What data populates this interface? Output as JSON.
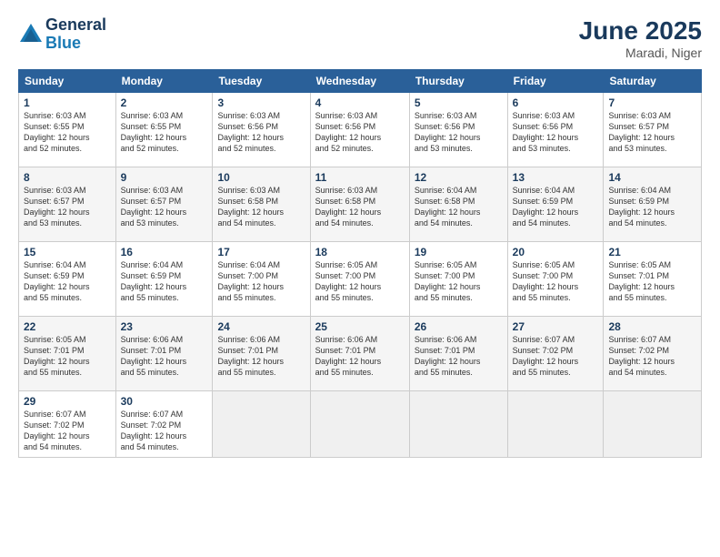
{
  "header": {
    "logo_line1": "General",
    "logo_line2": "Blue",
    "month": "June 2025",
    "location": "Maradi, Niger"
  },
  "days_of_week": [
    "Sunday",
    "Monday",
    "Tuesday",
    "Wednesday",
    "Thursday",
    "Friday",
    "Saturday"
  ],
  "weeks": [
    [
      {
        "day": "1",
        "info": "Sunrise: 6:03 AM\nSunset: 6:55 PM\nDaylight: 12 hours\nand 52 minutes."
      },
      {
        "day": "2",
        "info": "Sunrise: 6:03 AM\nSunset: 6:55 PM\nDaylight: 12 hours\nand 52 minutes."
      },
      {
        "day": "3",
        "info": "Sunrise: 6:03 AM\nSunset: 6:56 PM\nDaylight: 12 hours\nand 52 minutes."
      },
      {
        "day": "4",
        "info": "Sunrise: 6:03 AM\nSunset: 6:56 PM\nDaylight: 12 hours\nand 52 minutes."
      },
      {
        "day": "5",
        "info": "Sunrise: 6:03 AM\nSunset: 6:56 PM\nDaylight: 12 hours\nand 53 minutes."
      },
      {
        "day": "6",
        "info": "Sunrise: 6:03 AM\nSunset: 6:56 PM\nDaylight: 12 hours\nand 53 minutes."
      },
      {
        "day": "7",
        "info": "Sunrise: 6:03 AM\nSunset: 6:57 PM\nDaylight: 12 hours\nand 53 minutes."
      }
    ],
    [
      {
        "day": "8",
        "info": "Sunrise: 6:03 AM\nSunset: 6:57 PM\nDaylight: 12 hours\nand 53 minutes."
      },
      {
        "day": "9",
        "info": "Sunrise: 6:03 AM\nSunset: 6:57 PM\nDaylight: 12 hours\nand 53 minutes."
      },
      {
        "day": "10",
        "info": "Sunrise: 6:03 AM\nSunset: 6:58 PM\nDaylight: 12 hours\nand 54 minutes."
      },
      {
        "day": "11",
        "info": "Sunrise: 6:03 AM\nSunset: 6:58 PM\nDaylight: 12 hours\nand 54 minutes."
      },
      {
        "day": "12",
        "info": "Sunrise: 6:04 AM\nSunset: 6:58 PM\nDaylight: 12 hours\nand 54 minutes."
      },
      {
        "day": "13",
        "info": "Sunrise: 6:04 AM\nSunset: 6:59 PM\nDaylight: 12 hours\nand 54 minutes."
      },
      {
        "day": "14",
        "info": "Sunrise: 6:04 AM\nSunset: 6:59 PM\nDaylight: 12 hours\nand 54 minutes."
      }
    ],
    [
      {
        "day": "15",
        "info": "Sunrise: 6:04 AM\nSunset: 6:59 PM\nDaylight: 12 hours\nand 55 minutes."
      },
      {
        "day": "16",
        "info": "Sunrise: 6:04 AM\nSunset: 6:59 PM\nDaylight: 12 hours\nand 55 minutes."
      },
      {
        "day": "17",
        "info": "Sunrise: 6:04 AM\nSunset: 7:00 PM\nDaylight: 12 hours\nand 55 minutes."
      },
      {
        "day": "18",
        "info": "Sunrise: 6:05 AM\nSunset: 7:00 PM\nDaylight: 12 hours\nand 55 minutes."
      },
      {
        "day": "19",
        "info": "Sunrise: 6:05 AM\nSunset: 7:00 PM\nDaylight: 12 hours\nand 55 minutes."
      },
      {
        "day": "20",
        "info": "Sunrise: 6:05 AM\nSunset: 7:00 PM\nDaylight: 12 hours\nand 55 minutes."
      },
      {
        "day": "21",
        "info": "Sunrise: 6:05 AM\nSunset: 7:01 PM\nDaylight: 12 hours\nand 55 minutes."
      }
    ],
    [
      {
        "day": "22",
        "info": "Sunrise: 6:05 AM\nSunset: 7:01 PM\nDaylight: 12 hours\nand 55 minutes."
      },
      {
        "day": "23",
        "info": "Sunrise: 6:06 AM\nSunset: 7:01 PM\nDaylight: 12 hours\nand 55 minutes."
      },
      {
        "day": "24",
        "info": "Sunrise: 6:06 AM\nSunset: 7:01 PM\nDaylight: 12 hours\nand 55 minutes."
      },
      {
        "day": "25",
        "info": "Sunrise: 6:06 AM\nSunset: 7:01 PM\nDaylight: 12 hours\nand 55 minutes."
      },
      {
        "day": "26",
        "info": "Sunrise: 6:06 AM\nSunset: 7:01 PM\nDaylight: 12 hours\nand 55 minutes."
      },
      {
        "day": "27",
        "info": "Sunrise: 6:07 AM\nSunset: 7:02 PM\nDaylight: 12 hours\nand 55 minutes."
      },
      {
        "day": "28",
        "info": "Sunrise: 6:07 AM\nSunset: 7:02 PM\nDaylight: 12 hours\nand 54 minutes."
      }
    ],
    [
      {
        "day": "29",
        "info": "Sunrise: 6:07 AM\nSunset: 7:02 PM\nDaylight: 12 hours\nand 54 minutes."
      },
      {
        "day": "30",
        "info": "Sunrise: 6:07 AM\nSunset: 7:02 PM\nDaylight: 12 hours\nand 54 minutes."
      },
      {
        "day": "",
        "info": ""
      },
      {
        "day": "",
        "info": ""
      },
      {
        "day": "",
        "info": ""
      },
      {
        "day": "",
        "info": ""
      },
      {
        "day": "",
        "info": ""
      }
    ]
  ]
}
